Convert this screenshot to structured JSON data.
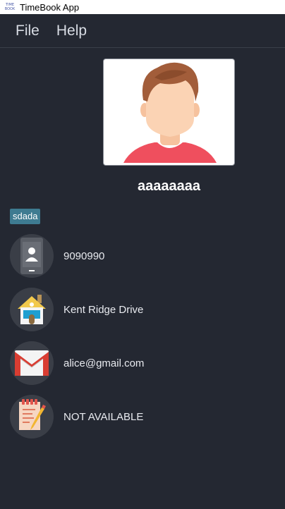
{
  "window": {
    "title": "TimeBook App",
    "logo_text": "TIME BOOK"
  },
  "menu": {
    "items": [
      "File",
      "Help"
    ]
  },
  "person": {
    "name": "aaaaaaaa",
    "tags": [
      "sdada"
    ],
    "phone": "9090990",
    "address": "Kent Ridge Drive",
    "email": "alice@gmail.com",
    "remark": "NOT AVAILABLE"
  },
  "icons": {
    "avatar": "person-avatar-icon",
    "phone": "phone-icon",
    "address": "house-icon",
    "email": "gmail-icon",
    "remark": "notepad-pencil-icon"
  },
  "colors": {
    "background": "#242832",
    "icon_circle": "#3a3e47",
    "tag": "#3e7b91",
    "text": "#e8eaef"
  }
}
